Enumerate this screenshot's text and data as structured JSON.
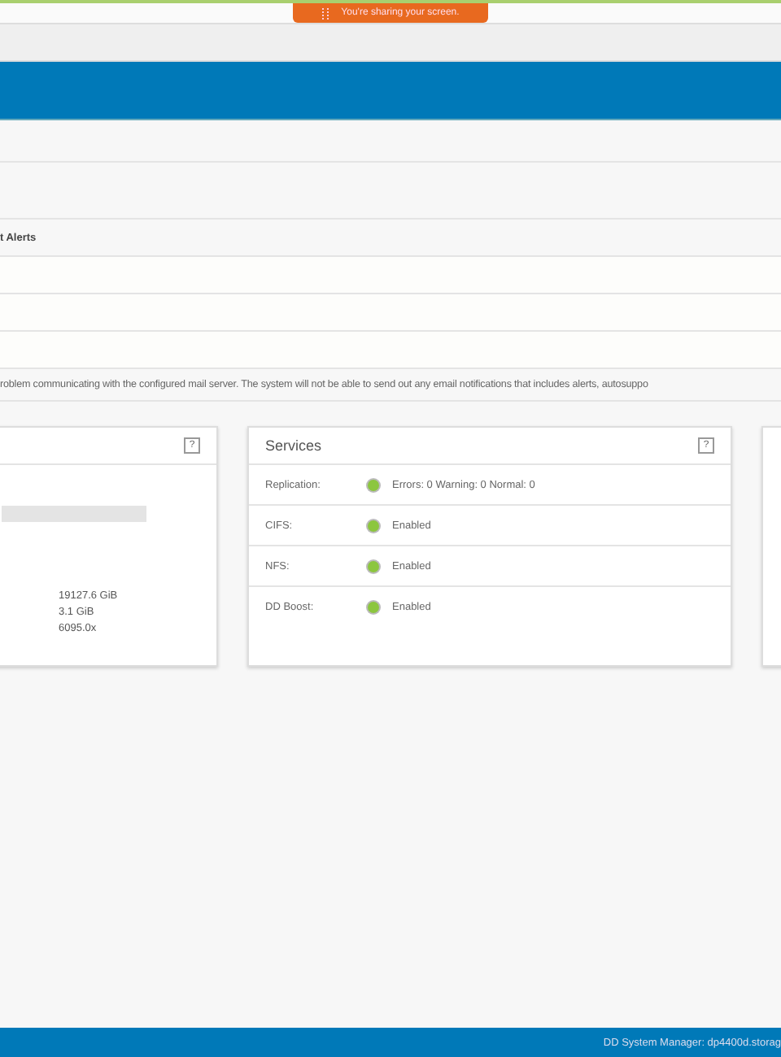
{
  "share_banner": {
    "text": "You're sharing your screen."
  },
  "alerts_header": {
    "title": "t Alerts"
  },
  "alert_message": {
    "text": "roblem communicating with the configured mail server. The system will not be able to send out any email notifications that includes alerts, autosuppo"
  },
  "left_card": {
    "help": "?",
    "values": [
      "19127.6 GiB",
      "3.1 GiB",
      "6095.0x"
    ]
  },
  "services": {
    "title": "Services",
    "help": "?",
    "rows": [
      {
        "label": "Replication:",
        "status": "Errors: 0 Warning: 0 Normal: 0",
        "color": "#8cc63f"
      },
      {
        "label": "CIFS:",
        "status": "Enabled",
        "color": "#8cc63f"
      },
      {
        "label": "NFS:",
        "status": "Enabled",
        "color": "#8cc63f"
      },
      {
        "label": "DD Boost:",
        "status": "Enabled",
        "color": "#8cc63f"
      }
    ]
  },
  "footer": {
    "text": "DD System Manager: dp4400d.storag"
  }
}
